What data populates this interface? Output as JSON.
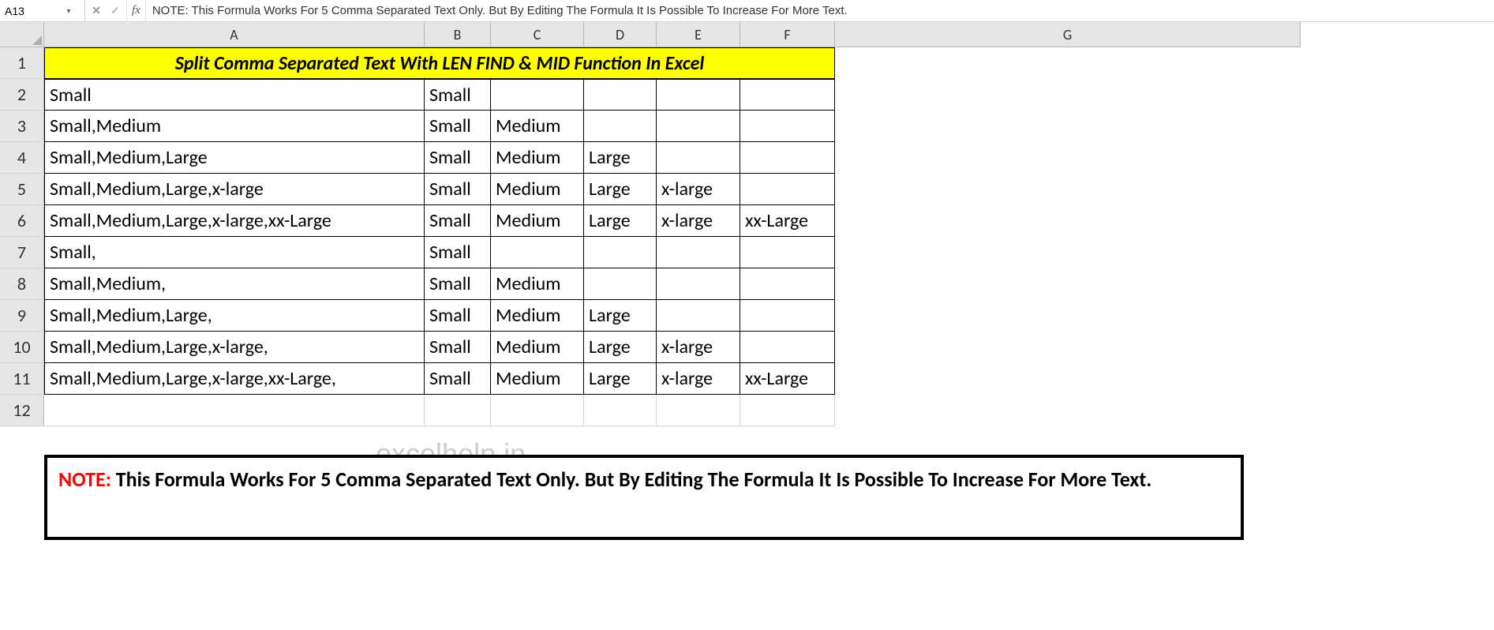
{
  "name_box": "A13",
  "formula_text": "NOTE: This Formula Works For 5 Comma Separated Text Only. But By Editing The Formula It Is Possible To Increase For More Text.",
  "columns": [
    "A",
    "B",
    "C",
    "D",
    "E",
    "F",
    "G"
  ],
  "rows_visible": [
    "1",
    "2",
    "3",
    "4",
    "5",
    "6",
    "7",
    "8",
    "9",
    "10",
    "11",
    "12"
  ],
  "title_cell": "Split Comma Separated Text With LEN FIND & MID Function In Excel",
  "data_rows": [
    {
      "a": "Small",
      "b": "Small",
      "c": "",
      "d": "",
      "e": "",
      "f": ""
    },
    {
      "a": "Small,Medium",
      "b": "Small",
      "c": "Medium",
      "d": "",
      "e": "",
      "f": ""
    },
    {
      "a": "Small,Medium,Large",
      "b": "Small",
      "c": "Medium",
      "d": "Large",
      "e": "",
      "f": ""
    },
    {
      "a": "Small,Medium,Large,x-large",
      "b": "Small",
      "c": "Medium",
      "d": "Large",
      "e": "x-large",
      "f": ""
    },
    {
      "a": "Small,Medium,Large,x-large,xx-Large",
      "b": "Small",
      "c": "Medium",
      "d": "Large",
      "e": "x-large",
      "f": "xx-Large"
    },
    {
      "a": "Small,",
      "b": "Small",
      "c": "",
      "d": "",
      "e": "",
      "f": ""
    },
    {
      "a": "Small,Medium,",
      "b": "Small",
      "c": "Medium",
      "d": "",
      "e": "",
      "f": ""
    },
    {
      "a": "Small,Medium,Large,",
      "b": "Small",
      "c": "Medium",
      "d": "Large",
      "e": "",
      "f": ""
    },
    {
      "a": "Small,Medium,Large,x-large,",
      "b": "Small",
      "c": "Medium",
      "d": "Large",
      "e": "x-large",
      "f": ""
    },
    {
      "a": "Small,Medium,Large,x-large,xx-Large,",
      "b": "Small",
      "c": "Medium",
      "d": "Large",
      "e": "x-large",
      "f": "xx-Large"
    }
  ],
  "note_prefix": "NOTE: ",
  "note_body": "This Formula Works For 5 Comma Separated Text Only. But By Editing The Formula It Is Possible To Increase For More Text.",
  "watermark": "excelhelp.in",
  "icons": {
    "dropdown": "▾",
    "cancel": "✕",
    "check": "✓",
    "fx": "fx"
  }
}
